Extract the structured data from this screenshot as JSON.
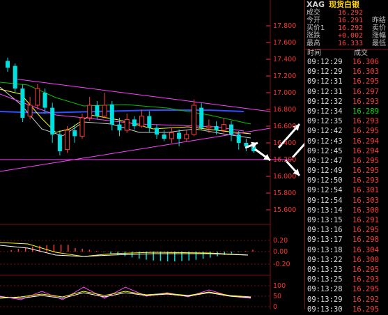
{
  "quote": {
    "symbol": "XAG",
    "name": "现货白银",
    "rows": [
      {
        "label": "成交",
        "value": "16.292",
        "extra": ""
      },
      {
        "label": "今开",
        "value": "16.291",
        "extra": "昨结"
      },
      {
        "label": "买价1",
        "value": "16.292",
        "extra": "卖价"
      },
      {
        "label": "涨跌",
        "value": "+0.002",
        "extra": "涨幅"
      },
      {
        "label": "最高",
        "value": "16.333",
        "extra": "最低"
      }
    ]
  },
  "ticks": {
    "header_time": "时间",
    "header_price": "成交",
    "rows": [
      {
        "time": "09:12:29",
        "price": "16.306",
        "dir": "up"
      },
      {
        "time": "09:12:29",
        "price": "16.303",
        "dir": "up"
      },
      {
        "time": "09:12:31",
        "price": "16.295",
        "dir": "up"
      },
      {
        "time": "09:12:31",
        "price": "16.297",
        "dir": "up"
      },
      {
        "time": "09:12:32",
        "price": "16.293",
        "dir": "up"
      },
      {
        "time": "09:12:34",
        "price": "16.289",
        "dir": "down"
      },
      {
        "time": "09:12:35",
        "price": "16.293",
        "dir": "up"
      },
      {
        "time": "09:12:42",
        "price": "16.295",
        "dir": "up"
      },
      {
        "time": "09:12:43",
        "price": "16.294",
        "dir": "up"
      },
      {
        "time": "09:12:45",
        "price": "16.294",
        "dir": "up"
      },
      {
        "time": "09:12:47",
        "price": "16.295",
        "dir": "up"
      },
      {
        "time": "09:12:49",
        "price": "16.295",
        "dir": "up"
      },
      {
        "time": "09:12:50",
        "price": "16.293",
        "dir": "up"
      },
      {
        "time": "09:12:54",
        "price": "16.301",
        "dir": "up"
      },
      {
        "time": "09:12:54",
        "price": "16.303",
        "dir": "up"
      },
      {
        "time": "09:13:14",
        "price": "16.300",
        "dir": "up"
      },
      {
        "time": "09:13:15",
        "price": "16.291",
        "dir": "up"
      },
      {
        "time": "09:13:16",
        "price": "16.295",
        "dir": "up"
      },
      {
        "time": "09:13:17",
        "price": "16.298",
        "dir": "up"
      },
      {
        "time": "09:13:18",
        "price": "16.304",
        "dir": "up"
      },
      {
        "time": "09:13:22",
        "price": "16.300",
        "dir": "up"
      },
      {
        "time": "09:13:23",
        "price": "16.295",
        "dir": "up"
      },
      {
        "time": "09:13:25",
        "price": "16.293",
        "dir": "up"
      },
      {
        "time": "09:13:28",
        "price": "16.295",
        "dir": "up"
      },
      {
        "time": "09:13:29",
        "price": "16.292",
        "dir": "up"
      },
      {
        "time": "09:13:30",
        "price": "16.295",
        "dir": "up"
      }
    ]
  },
  "main_axis": {
    "labels": [
      "17.800",
      "17.600",
      "17.400",
      "17.200",
      "17.000",
      "16.800",
      "16.600",
      "16.400",
      "16.200",
      "16.000",
      "15.800",
      "15.600"
    ]
  },
  "macd_axis": {
    "labels": [
      "0.20",
      "0.00",
      "-0.20"
    ]
  },
  "kdj_axis": {
    "labels": [
      "100",
      "50",
      "0"
    ]
  },
  "colors": {
    "up": "#ff3c3c",
    "down": "#00e0e0",
    "axis": "#ff3030",
    "grid": "#7a1010"
  }
}
